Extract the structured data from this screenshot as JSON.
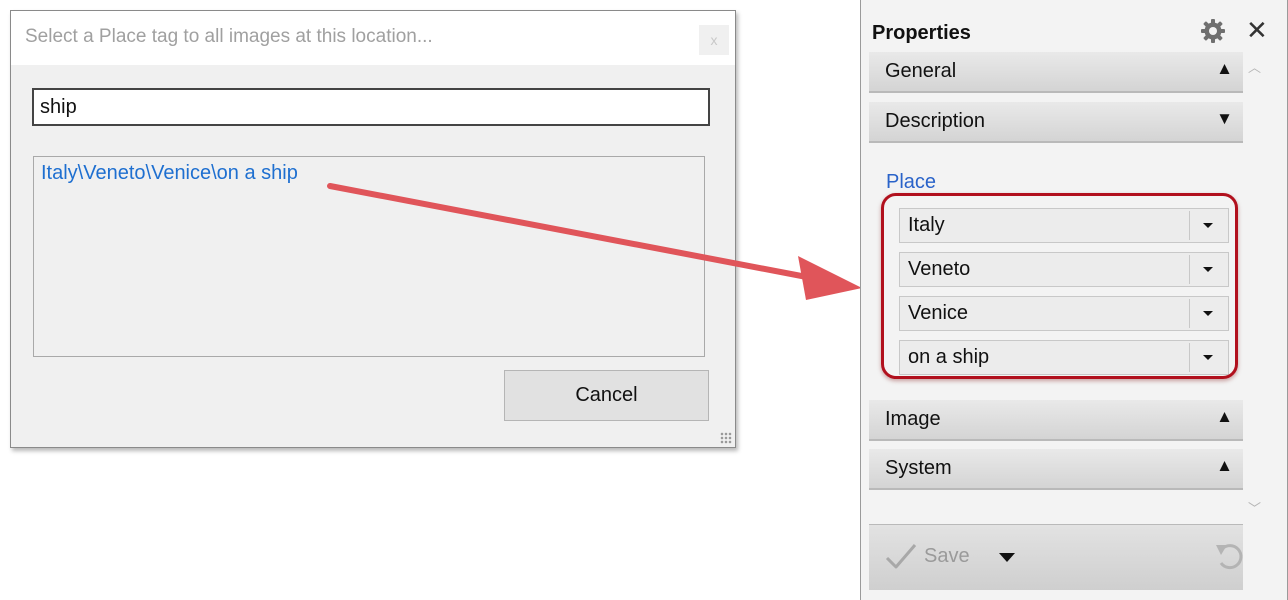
{
  "dialog": {
    "title": "Select a Place tag to all images at this location...",
    "close_label": "x",
    "search_value": "ship",
    "results": [
      "Italy\\Veneto\\Venice\\on a ship"
    ],
    "cancel_label": "Cancel"
  },
  "panel": {
    "title": "Properties",
    "sections": {
      "general": "General",
      "description": "Description",
      "image": "Image",
      "system": "System"
    },
    "place_label": "Place",
    "place_levels": [
      "Italy",
      "Veneto",
      "Venice",
      "on a ship"
    ],
    "footer": {
      "save_label": "Save"
    }
  },
  "icons": {
    "gear": "gear-icon",
    "close": "close-icon",
    "chevron_up": "chevron-up-icon",
    "chevron_down": "chevron-down-icon",
    "dropdown": "dropdown-arrow-icon",
    "check": "check-icon",
    "undo": "undo-icon",
    "arrow": "annotation-arrow"
  },
  "colors": {
    "annotation_arrow": "#e0555a",
    "highlight_border": "#b1101d",
    "place_label": "#2a63c9",
    "result_link": "#1e6fd0"
  }
}
